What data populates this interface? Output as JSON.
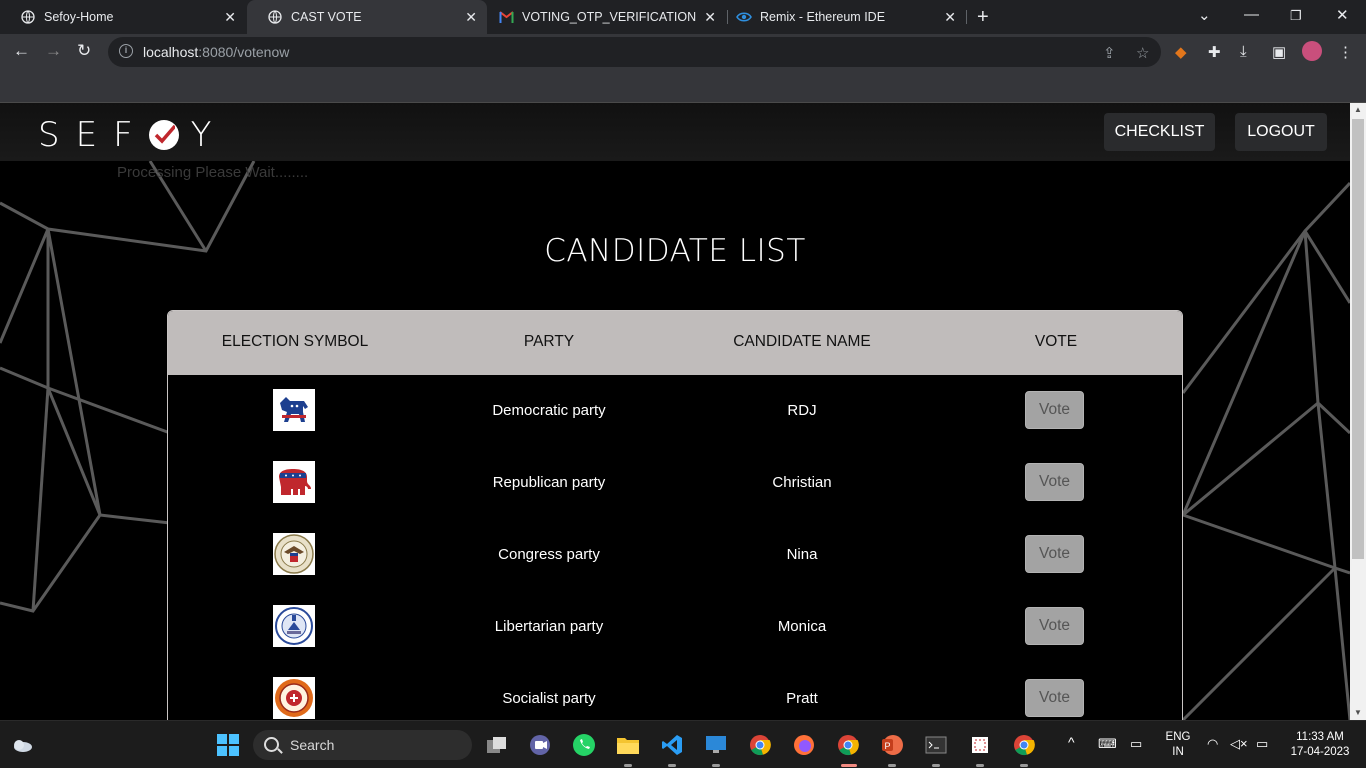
{
  "browser": {
    "tabs": [
      {
        "title": "Sefoy-Home",
        "active": false
      },
      {
        "title": "CAST VOTE",
        "active": true
      },
      {
        "title": "VOTING_OTP_VERIFICATION - sh",
        "active": false
      },
      {
        "title": "Remix - Ethereum IDE",
        "active": false
      }
    ],
    "url_host": "localhost",
    "url_path": ":8080/votenow"
  },
  "page": {
    "logo_left": "SEF",
    "logo_right": "Y",
    "nav": {
      "checklist": "CHECKLIST",
      "logout": "LOGOUT"
    },
    "processing": "Processing Please Wait........",
    "heading": "CANDIDATE LIST",
    "table": {
      "headers": [
        "ELECTION SYMBOL",
        "PARTY",
        "CANDIDATE NAME",
        "VOTE"
      ],
      "rows": [
        {
          "symbol": "democratic-donkey-icon",
          "party": "Democratic party",
          "candidate": "RDJ",
          "vote": "Vote"
        },
        {
          "symbol": "republican-elephant-icon",
          "party": "Republican party",
          "candidate": "Christian",
          "vote": "Vote"
        },
        {
          "symbol": "eagle-seal-icon",
          "party": "Congress party",
          "candidate": "Nina",
          "vote": "Vote"
        },
        {
          "symbol": "libertarian-seal-icon",
          "party": "Libertarian party",
          "candidate": "Monica",
          "vote": "Vote"
        },
        {
          "symbol": "socialist-seal-icon",
          "party": "Socialist party",
          "candidate": "Pratt",
          "vote": "Vote"
        }
      ]
    }
  },
  "taskbar": {
    "search": "Search",
    "lang": "ENG",
    "region": "IN",
    "time": "11:33 AM",
    "date": "17-04-2023"
  }
}
